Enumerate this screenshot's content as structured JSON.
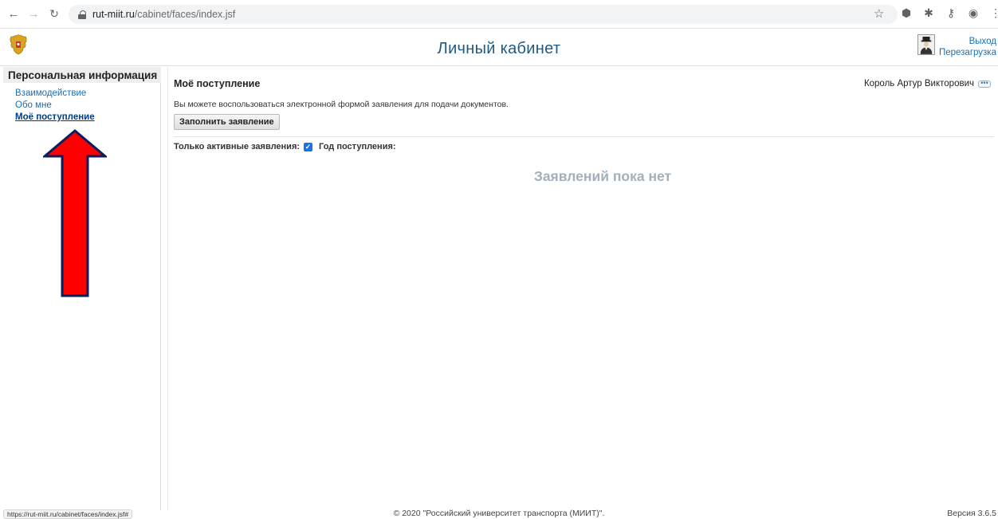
{
  "browser": {
    "url_host": "rut-miit.ru",
    "url_path": "/cabinet/faces/index.jsf",
    "status_url": "https://rut-miit.ru/cabinet/faces/index.jsf#"
  },
  "header": {
    "title": "Личный кабинет",
    "logout": "Выход",
    "reload": "Перезагрузка"
  },
  "sidebar": {
    "heading": "Персональная информация",
    "items": [
      {
        "label": "Взаимодействие",
        "active": false
      },
      {
        "label": "Обо мне",
        "active": false
      },
      {
        "label": "Моё поступление",
        "active": true
      }
    ]
  },
  "main": {
    "title": "Моё поступление",
    "user_name": "Король Артур Викторович",
    "more_label": "•••",
    "info": "Вы можете воспользоваться электронной формой заявления для подачи документов.",
    "fill_button": "Заполнить заявление",
    "filter_active_label": "Только активные заявления:",
    "filter_active_checked": true,
    "filter_year_label": "Год поступления:",
    "empty_message": "Заявлений пока нет"
  },
  "footer": {
    "copyright": "© 2020 \"Российский университет транспорта (МИИТ)\".",
    "version": "Версия 3.6.5"
  },
  "colors": {
    "accent": "#1a6fb5",
    "title": "#1f5a85",
    "annotation_arrow": "#ff0000"
  }
}
